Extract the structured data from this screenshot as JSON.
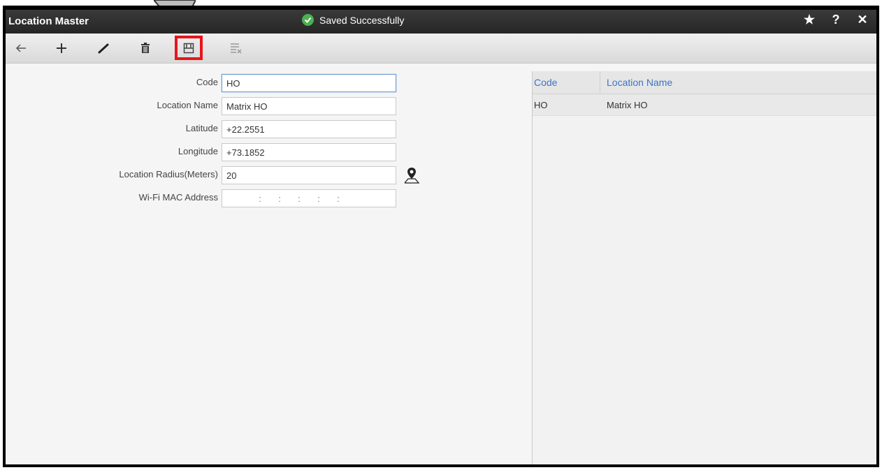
{
  "window": {
    "title": "Location Master",
    "status_message": "Saved Successfully"
  },
  "title_actions": [
    "★",
    "?",
    "✕"
  ],
  "toolbar": {
    "items": [
      "back-icon",
      "add-icon",
      "edit-icon",
      "delete-icon",
      "save-icon",
      "clear-icon"
    ],
    "highlighted": "save-icon",
    "highlight_color": "#e8141b"
  },
  "form": {
    "code_label": "Code",
    "code_value": "HO",
    "location_name_label": "Location Name",
    "location_name_value": "Matrix HO",
    "latitude_label": "Latitude",
    "latitude_value": "+22.2551",
    "longitude_label": "Longitude",
    "longitude_value": "+73.1852",
    "radius_label": "Location Radius(Meters)",
    "radius_value": "20",
    "mac_label": "Wi-Fi MAC Address",
    "mac_separator": ":"
  },
  "grid": {
    "headers": [
      "Code",
      "Location Name"
    ],
    "rows": [
      [
        "HO",
        "Matrix HO"
      ]
    ]
  }
}
